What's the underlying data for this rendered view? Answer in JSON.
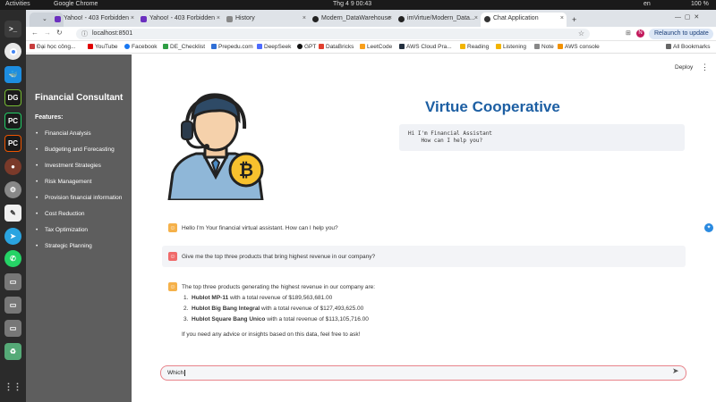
{
  "os": {
    "activities": "Activities",
    "app_name": "Google Chrome",
    "clock": "Thg 4 9  00:43",
    "lang": "en",
    "battery": "100 %"
  },
  "tabs": [
    {
      "label": "Yahoo! - 403 Forbidden",
      "color": "#6b2fbf"
    },
    {
      "label": "Yahoo! - 403 Forbidden",
      "color": "#6b2fbf"
    },
    {
      "label": "History",
      "color": "#888888"
    },
    {
      "label": "Modern_DataWarehouse",
      "color": "#222222"
    },
    {
      "label": "imVirtue/Modern_Data...",
      "color": "#222222"
    },
    {
      "label": "Chat Application",
      "color": "#333333"
    }
  ],
  "address": {
    "url": "localhost:8501",
    "relaunch_label": "Relaunch to update"
  },
  "bookmarks": [
    {
      "label": "Đại học công...",
      "color": "#c73d3d"
    },
    {
      "label": "YouTube",
      "color": "#e00000"
    },
    {
      "label": "Facebook",
      "color": "#1877f2"
    },
    {
      "label": "DE_Checklist",
      "color": "#2f9e44"
    },
    {
      "label": "Prepedu.com",
      "color": "#2f6fd6"
    },
    {
      "label": "DeepSeek",
      "color": "#4d6bfe"
    },
    {
      "label": "GPT",
      "color": "#111111"
    },
    {
      "label": "DataBricks",
      "color": "#e0402f"
    },
    {
      "label": "LeetCode",
      "color": "#f89f1b"
    },
    {
      "label": "AWS Cloud Pra...",
      "color": "#232f3e"
    },
    {
      "label": "Reading",
      "color": "#f2b400"
    },
    {
      "label": "Listening",
      "color": "#f2b400"
    },
    {
      "label": "Note",
      "color": "#888888"
    },
    {
      "label": "AWS console",
      "color": "#f29100"
    },
    {
      "label": "All Bookmarks",
      "color": "#666666"
    }
  ],
  "sidebar": {
    "title": "Financial Consultant",
    "features_label": "Features:",
    "items": [
      "Financial Analysis",
      "Budgeting and Forecasting",
      "Investment Strategies",
      "Risk Management",
      "Provision financial information",
      "Cost Reduction",
      "Tax Optimization",
      "Strategic Planning"
    ]
  },
  "header": {
    "deploy_label": "Deploy",
    "heading": "Virtue Cooperative",
    "code_text": "Hi I'm Financial Assistant\n    How can I help you?"
  },
  "chat": {
    "greeting": "Hello I'm Your financial virtual assistant. How can I help you?",
    "user_question": "Give me the top three products that bring highest revenue in our company?",
    "answer_intro": "The top three products generating the highest revenue in our company are:",
    "answer_items": [
      {
        "num": "1.",
        "name": "Hublot MP-11",
        "rest": " with a total revenue of $189,563,681.00"
      },
      {
        "num": "2.",
        "name": "Hublot Big Bang Integral",
        "rest": " with a total revenue of $127,493,625.00"
      },
      {
        "num": "3.",
        "name": "Hublot Square Bang Unico",
        "rest": " with a total revenue of $113,105,716.00"
      }
    ],
    "answer_outro": "If you need any advice or insights based on this data, feel free to ask!"
  },
  "input": {
    "value": "Which"
  },
  "colors": {
    "sidebar_bg": "#5e5e5e",
    "heading": "#1d5fa3",
    "assistant_icon": "#f5b14a",
    "user_icon": "#f06a6a",
    "input_border": "#e8838a"
  }
}
